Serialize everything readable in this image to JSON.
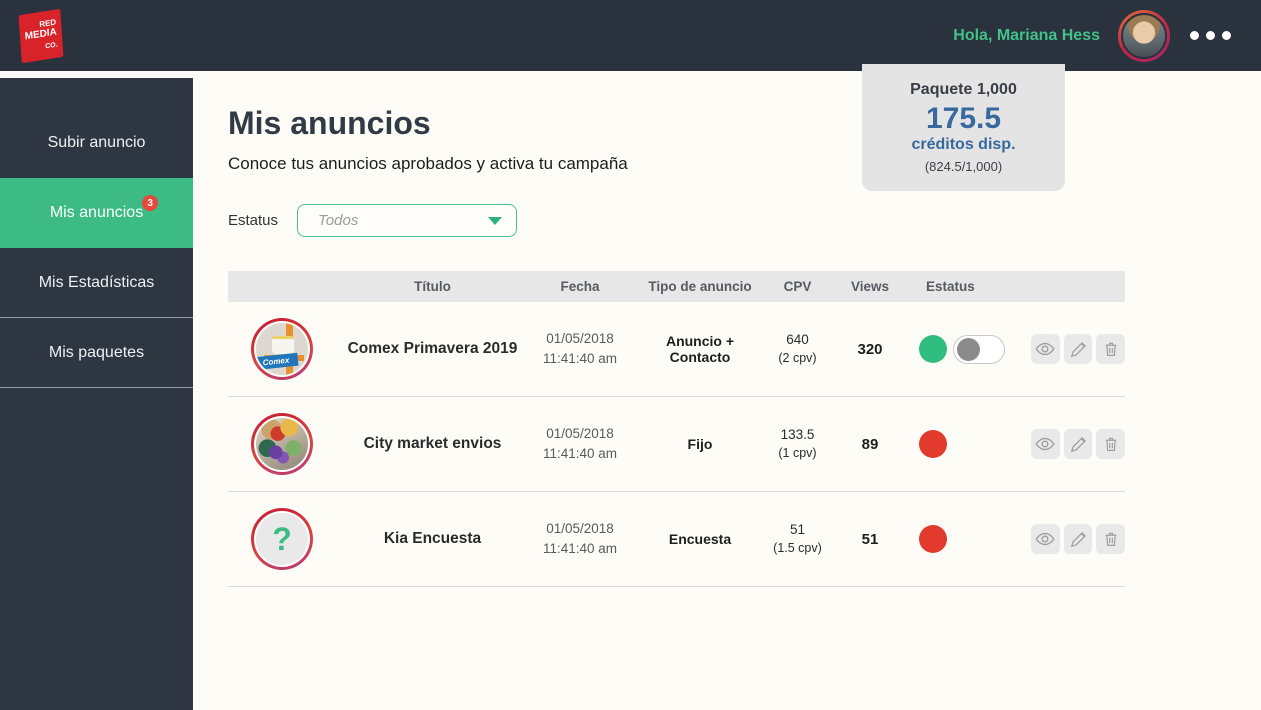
{
  "header": {
    "logo_lines": [
      "RED",
      "MEDIA",
      "CO."
    ],
    "greeting": "Hola, Mariana Hess"
  },
  "sidebar": {
    "items": [
      {
        "label": "Subir anuncio"
      },
      {
        "label": "Mis anuncios",
        "badge": "3",
        "active": true
      },
      {
        "label": "Mis Estadísticas"
      },
      {
        "label": "Mis paquetes"
      }
    ]
  },
  "credits_card": {
    "package": "Paquete 1,000",
    "value": "175.5",
    "label": "créditos disp.",
    "detail": "(824.5/1,000)"
  },
  "page": {
    "title": "Mis anuncios",
    "subtitle": "Conoce tus anuncios aprobados y activa tu campaña"
  },
  "filter": {
    "label": "Estatus",
    "value": "Todos"
  },
  "table": {
    "headers": {
      "title": "Título",
      "date": "Fecha",
      "type": "Tipo de anuncio",
      "cpv": "CPV",
      "views": "Views",
      "status": "Estatus"
    },
    "rows": [
      {
        "avatar": "comex-paint-photo",
        "avatar_text": "Comex",
        "title": "Comex Primavera 2019",
        "date": "01/05/2018",
        "time": "11:41:40 am",
        "type": "Anuncio + Contacto",
        "cpv": "640",
        "cpv_note": "(2 cpv)",
        "views": "320",
        "status": "on",
        "has_toggle": true
      },
      {
        "avatar": "groceries-photo",
        "title": "City market envios",
        "date": "01/05/2018",
        "time": "11:41:40 am",
        "type": "Fijo",
        "cpv": "133.5",
        "cpv_note": "(1 cpv)",
        "views": "89",
        "status": "off",
        "has_toggle": false
      },
      {
        "avatar": "question-mark",
        "avatar_text": "?",
        "title": "Kia Encuesta",
        "date": "01/05/2018",
        "time": "11:41:40 am",
        "type": "Encuesta",
        "cpv": "51",
        "cpv_note": "(1.5 cpv)",
        "views": "51",
        "status": "off",
        "has_toggle": false
      }
    ]
  },
  "colors": {
    "topbar": "#2a323d",
    "sidebar": "#2d3641",
    "accent_green": "#3cbb84",
    "status_green": "#31bd7f",
    "status_red": "#e23a2c",
    "credits_blue": "#38699e",
    "badge_red": "#e8473a",
    "logo_red": "#d8232a"
  }
}
